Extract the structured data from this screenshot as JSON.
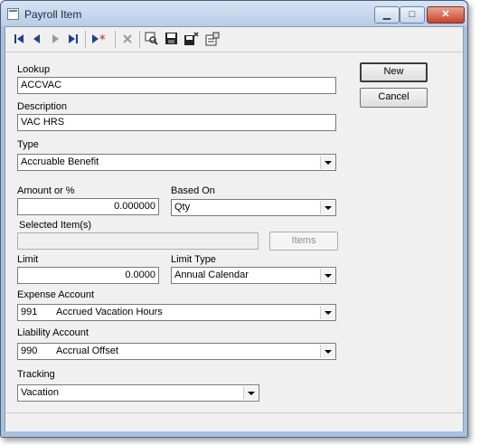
{
  "window": {
    "title": "Payroll Item"
  },
  "toolbar": {
    "icons": [
      "first-record-icon",
      "previous-record-icon",
      "next-record-icon",
      "last-record-icon",
      "new-record-icon",
      "delete-icon",
      "find-icon",
      "save-icon",
      "save-close-icon",
      "properties-icon"
    ]
  },
  "form": {
    "lookup": {
      "label": "Lookup",
      "value": "ACCVAC"
    },
    "description": {
      "label": "Description",
      "value": "VAC HRS"
    },
    "type": {
      "label": "Type",
      "value": "Accruable Benefit"
    },
    "amount": {
      "label": "Amount or %",
      "value": "0.000000"
    },
    "based_on": {
      "label": "Based On",
      "value": "Qty"
    },
    "selected_items": {
      "label": "Selected Item(s)",
      "value": "",
      "button": "Items"
    },
    "limit": {
      "label": "Limit",
      "value": "0.0000"
    },
    "limit_type": {
      "label": "Limit Type",
      "value": "Annual Calendar"
    },
    "expense_account": {
      "label": "Expense Account",
      "number": "991",
      "name": "Accrued Vacation Hours"
    },
    "liability_account": {
      "label": "Liability Account",
      "number": "990",
      "name": "Accrual Offset"
    },
    "tracking": {
      "label": "Tracking",
      "value": "Vacation"
    }
  },
  "buttons": {
    "new": "New",
    "cancel": "Cancel"
  }
}
